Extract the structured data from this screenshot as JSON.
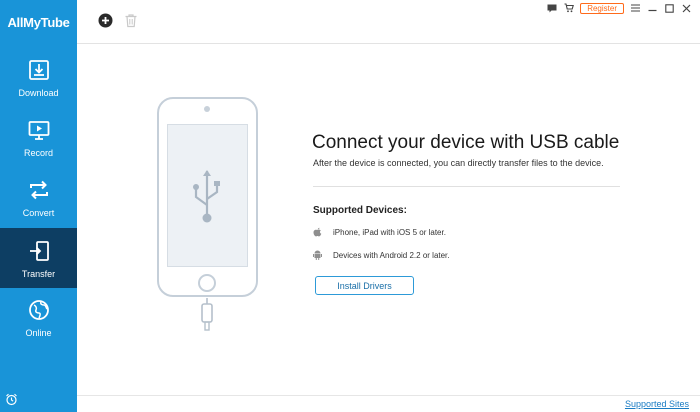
{
  "app": {
    "title": "AllMyTube"
  },
  "sidebar": {
    "items": [
      {
        "label": "Download",
        "icon": "download-icon",
        "active": false
      },
      {
        "label": "Record",
        "icon": "monitor-record-icon",
        "active": false
      },
      {
        "label": "Convert",
        "icon": "convert-arrows-icon",
        "active": false
      },
      {
        "label": "Transfer",
        "icon": "transfer-icon",
        "active": true
      },
      {
        "label": "Online",
        "icon": "globe-icon",
        "active": false
      }
    ],
    "bottom_icon": "alarm-clock-icon"
  },
  "toolbar": {
    "add_icon": "add-circle-icon",
    "delete_icon": "trash-icon"
  },
  "window": {
    "register_label": "Register",
    "icons": [
      "message-icon",
      "cart-icon",
      "menu-icon",
      "minimize-icon",
      "maximize-icon",
      "close-icon"
    ]
  },
  "main": {
    "headline": "Connect your device with USB cable",
    "subline": "After the device is connected, you can directly transfer files to the device.",
    "supported_title": "Supported Devices:",
    "devices": [
      {
        "icon": "apple-icon",
        "text": "iPhone, iPad with iOS 5 or later."
      },
      {
        "icon": "android-icon",
        "text": "Devices with Android 2.2 or later."
      }
    ],
    "install_button": "Install Drivers"
  },
  "footer": {
    "link": "Supported Sites"
  },
  "colors": {
    "sidebar": "#1994d8",
    "sidebar_active": "#0d3e63",
    "register": "#ff6a1a",
    "link": "#1a7cc4"
  }
}
